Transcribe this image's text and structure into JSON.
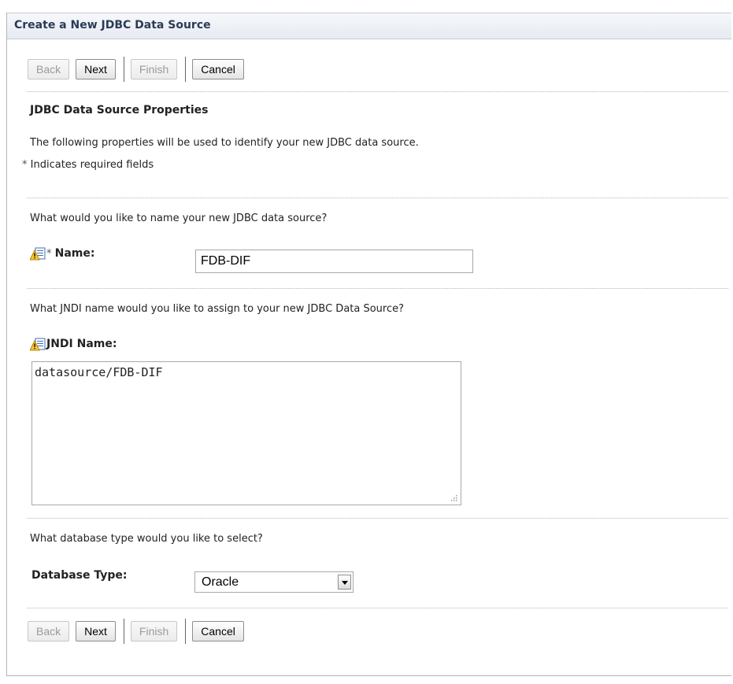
{
  "panel": {
    "title": "Create a New JDBC Data Source"
  },
  "buttons": {
    "back": "Back",
    "next": "Next",
    "finish": "Finish",
    "cancel": "Cancel"
  },
  "section": {
    "heading": "JDBC Data Source Properties",
    "description": "The following properties will be used to identify your new JDBC data source.",
    "required_star": "*",
    "required_note": "Indicates required fields"
  },
  "name_field": {
    "question": "What would you like to name your new JDBC data source?",
    "required_star": "*",
    "label": "Name:",
    "value": "FDB-DIF",
    "icon": "warning-edit-icon"
  },
  "jndi_field": {
    "question": "What JNDI name would you like to assign to your new JDBC Data Source?",
    "label": "JNDI Name:",
    "value": "datasource/FDB-DIF",
    "icon": "warning-edit-icon"
  },
  "db_type": {
    "question": "What database type would you like to select?",
    "label": "Database Type:",
    "selected": "Oracle"
  }
}
